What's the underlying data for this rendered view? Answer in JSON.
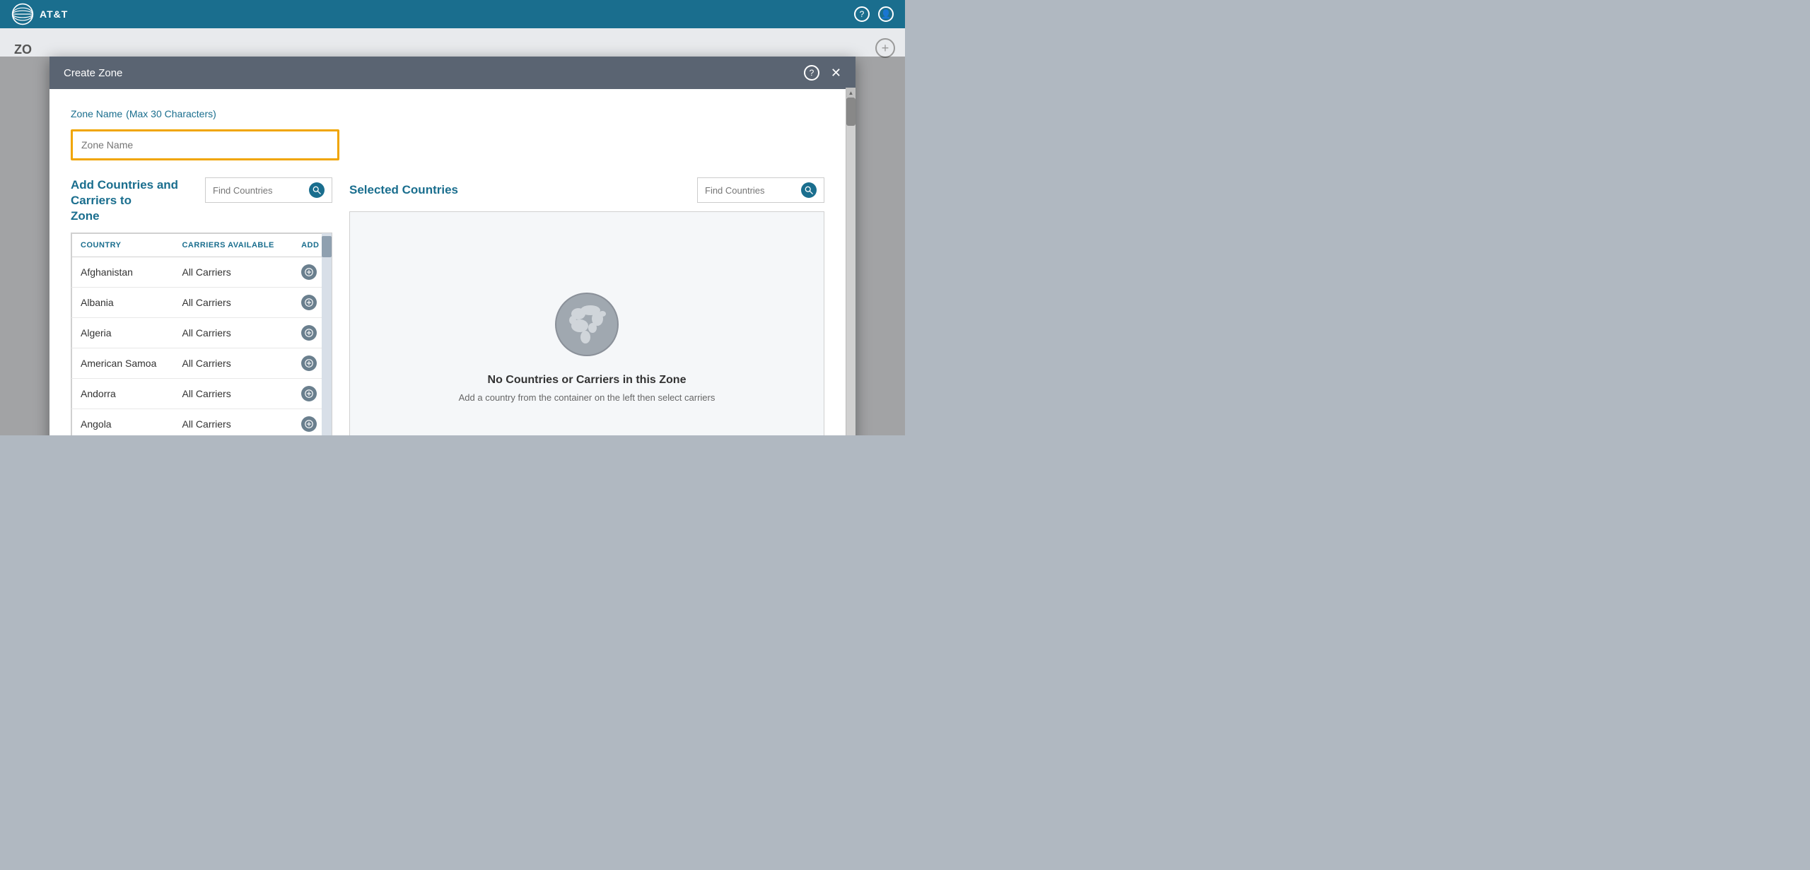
{
  "header": {
    "brand": "AT&T",
    "help_icon_label": "?",
    "user_icon_label": "👤"
  },
  "page": {
    "bg_text": "ZO",
    "add_button_label": "+"
  },
  "modal": {
    "title": "Create Zone",
    "help_label": "?",
    "close_label": "✕"
  },
  "zone_name": {
    "label": "Zone Name",
    "max_chars_note": "(Max 30 Characters)",
    "placeholder": "Zone Name"
  },
  "left_panel": {
    "title_line1": "Add Countries and Carriers to",
    "title_line2": "Zone",
    "find_placeholder": "Find Countries",
    "table": {
      "col_country": "COUNTRY",
      "col_carriers": "CARRIERS AVAILABLE",
      "col_add": "ADD",
      "rows": [
        {
          "country": "Afghanistan",
          "carriers": "All Carriers"
        },
        {
          "country": "Albania",
          "carriers": "All Carriers"
        },
        {
          "country": "Algeria",
          "carriers": "All Carriers"
        },
        {
          "country": "American Samoa",
          "carriers": "All Carriers"
        },
        {
          "country": "Andorra",
          "carriers": "All Carriers"
        },
        {
          "country": "Angola",
          "carriers": "All Carriers"
        }
      ]
    }
  },
  "right_panel": {
    "title": "Selected Countries",
    "find_placeholder": "Find Countries",
    "empty_title": "No Countries or Carriers in this Zone",
    "empty_sub": "Add a country from the container on the left then select carriers"
  }
}
